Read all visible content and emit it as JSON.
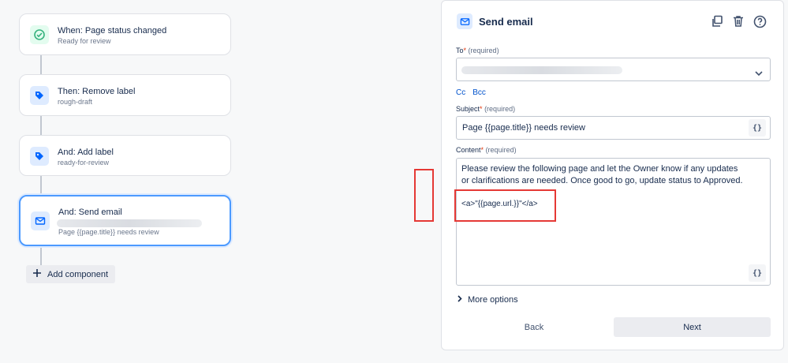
{
  "flow": {
    "cards": [
      {
        "title": "When: Page status changed",
        "subtitle": "Ready for review",
        "icon": "check-circle-icon",
        "color": "#36b37e"
      },
      {
        "title": "Then: Remove label",
        "subtitle": "rough-draft",
        "icon": "tag-icon",
        "color": "#0065ff"
      },
      {
        "title": "And: Add label",
        "subtitle": "ready-for-review",
        "icon": "tag-icon",
        "color": "#0065ff"
      },
      {
        "title": "And: Send email",
        "subtitle": "Page {{page.title}} needs review",
        "icon": "mail-icon",
        "color": "#0065ff",
        "selected": true
      }
    ],
    "add_component_label": "Add component"
  },
  "panel": {
    "title": "Send email",
    "to": {
      "label": "To",
      "required_marker": "*",
      "hint": "(required)"
    },
    "cc_label": "Cc",
    "bcc_label": "Bcc",
    "subject": {
      "label": "Subject",
      "required_marker": "*",
      "hint": "(required)",
      "value": "Page {{page.title}} needs review"
    },
    "content": {
      "label": "Content",
      "required_marker": "*",
      "hint": "(required)",
      "body": "Please review the following page and let the Owner know if any updates or clarifications are needed. Once good to go, update status to Approved.",
      "code": "<a>\"{{page.url.}}\"</a>"
    },
    "smart_value_label": "{}",
    "more_options_label": "More options",
    "back_label": "Back",
    "next_label": "Next"
  },
  "colors": {
    "accent": "#0052cc",
    "highlight": "#e53935",
    "selected_border": "#4c9aff"
  }
}
